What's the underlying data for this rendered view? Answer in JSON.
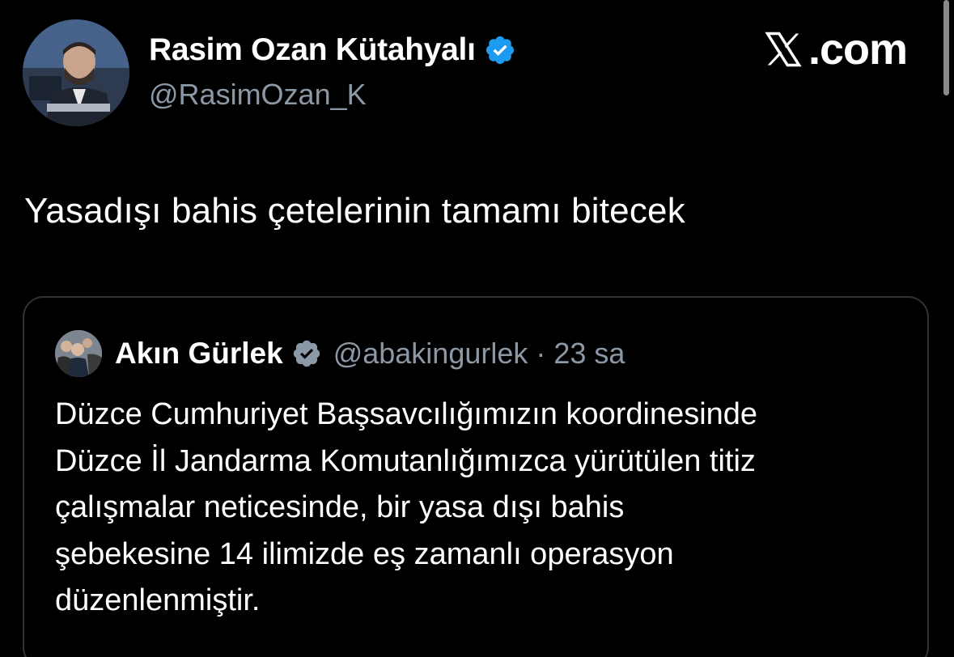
{
  "author": {
    "name": "Rasim Ozan Kütahyalı",
    "handle": "@RasimOzan_K",
    "verified": true,
    "avatar_icon": "profile-photo"
  },
  "brand": {
    "logo_icon": "x-logo-icon",
    "text": ".com"
  },
  "tweet": {
    "text": "Yasadışı bahis çetelerinin tamamı bitecek"
  },
  "quoted_tweet": {
    "name": "Akın Gürlek",
    "handle": "@abakingurlek",
    "separator": "·",
    "time": "23 sa",
    "verified": true,
    "lines": [
      "Düzce Cumhuriyet Başsavcılığımızın koordinesinde",
      "Düzce İl Jandarma Komutanlığımızca yürütülen titiz",
      "çalışmalar neticesinde, bir yasa dışı bahis",
      "şebekesine 14 ilimizde eş zamanlı operasyon",
      "düzenlenmiştir."
    ]
  },
  "colors": {
    "background": "#000000",
    "primary_text": "#ffffff",
    "secondary_text": "#8b98a5",
    "verified_badge": "#1d9bf0",
    "card_border": "#2f3336"
  }
}
